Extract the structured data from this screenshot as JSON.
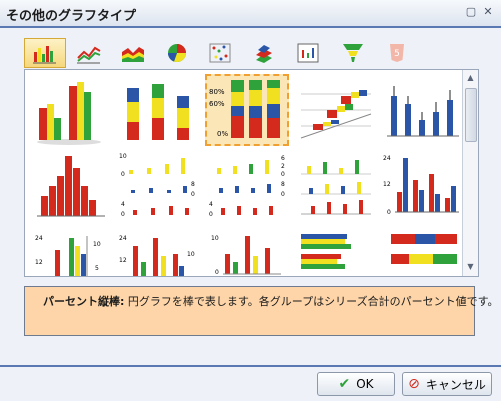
{
  "window": {
    "title": "その他のグラフタイプ",
    "restore_icon": "restore-icon",
    "close_icon": "close-icon"
  },
  "tabs": [
    {
      "icon": "bar-chart-icon",
      "active": true
    },
    {
      "icon": "line-chart-icon"
    },
    {
      "icon": "area-chart-icon"
    },
    {
      "icon": "pie-chart-icon"
    },
    {
      "icon": "scatter-chart-icon"
    },
    {
      "icon": "3d-chart-icon"
    },
    {
      "icon": "stock-chart-icon"
    },
    {
      "icon": "funnel-chart-icon"
    },
    {
      "icon": "html5-icon"
    }
  ],
  "gallery": {
    "selected_index": 2,
    "thumbs": [
      {
        "name": "3d-clustered-bar"
      },
      {
        "name": "3d-stacked-bar"
      },
      {
        "name": "percent-stacked-bar",
        "tick_labels": [
          "80%",
          "60%",
          "0%"
        ]
      },
      {
        "name": "3d-depth-bar"
      },
      {
        "name": "bar-error-bars"
      },
      {
        "name": "histogram-3d"
      },
      {
        "name": "side-by-side-multi-axis",
        "tick_labels": [
          "10",
          "0",
          "8",
          "0",
          "4",
          "0"
        ]
      },
      {
        "name": "multi-panel-bars",
        "tick_labels": [
          "6",
          "2",
          "0",
          "8",
          "0",
          "4",
          "0"
        ]
      },
      {
        "name": "grid-bars"
      },
      {
        "name": "dual-axis-bar",
        "tick_labels": [
          "24",
          "12",
          "0"
        ]
      },
      {
        "name": "dual-axis-stacked",
        "tick_labels": [
          "24",
          "12",
          "10",
          "5"
        ]
      },
      {
        "name": "multi-axis-bar",
        "tick_labels": [
          "24",
          "12",
          "10"
        ]
      },
      {
        "name": "multi-axis-bar-2",
        "tick_labels": [
          "10",
          "0"
        ]
      },
      {
        "name": "horizontal-bar"
      },
      {
        "name": "horizontal-stacked-bar"
      }
    ]
  },
  "description": {
    "label": "パーセント縦棒:",
    "text": " 円グラフを棒で表します。各グループはシリーズ合計のパーセント値です。"
  },
  "buttons": {
    "ok": "OK",
    "cancel": "キャンセル"
  },
  "colors": {
    "red": "#d42a1e",
    "yellow": "#f1e020",
    "green": "#2fa23c",
    "blue": "#2b56a8",
    "accent": "#f0a030"
  }
}
